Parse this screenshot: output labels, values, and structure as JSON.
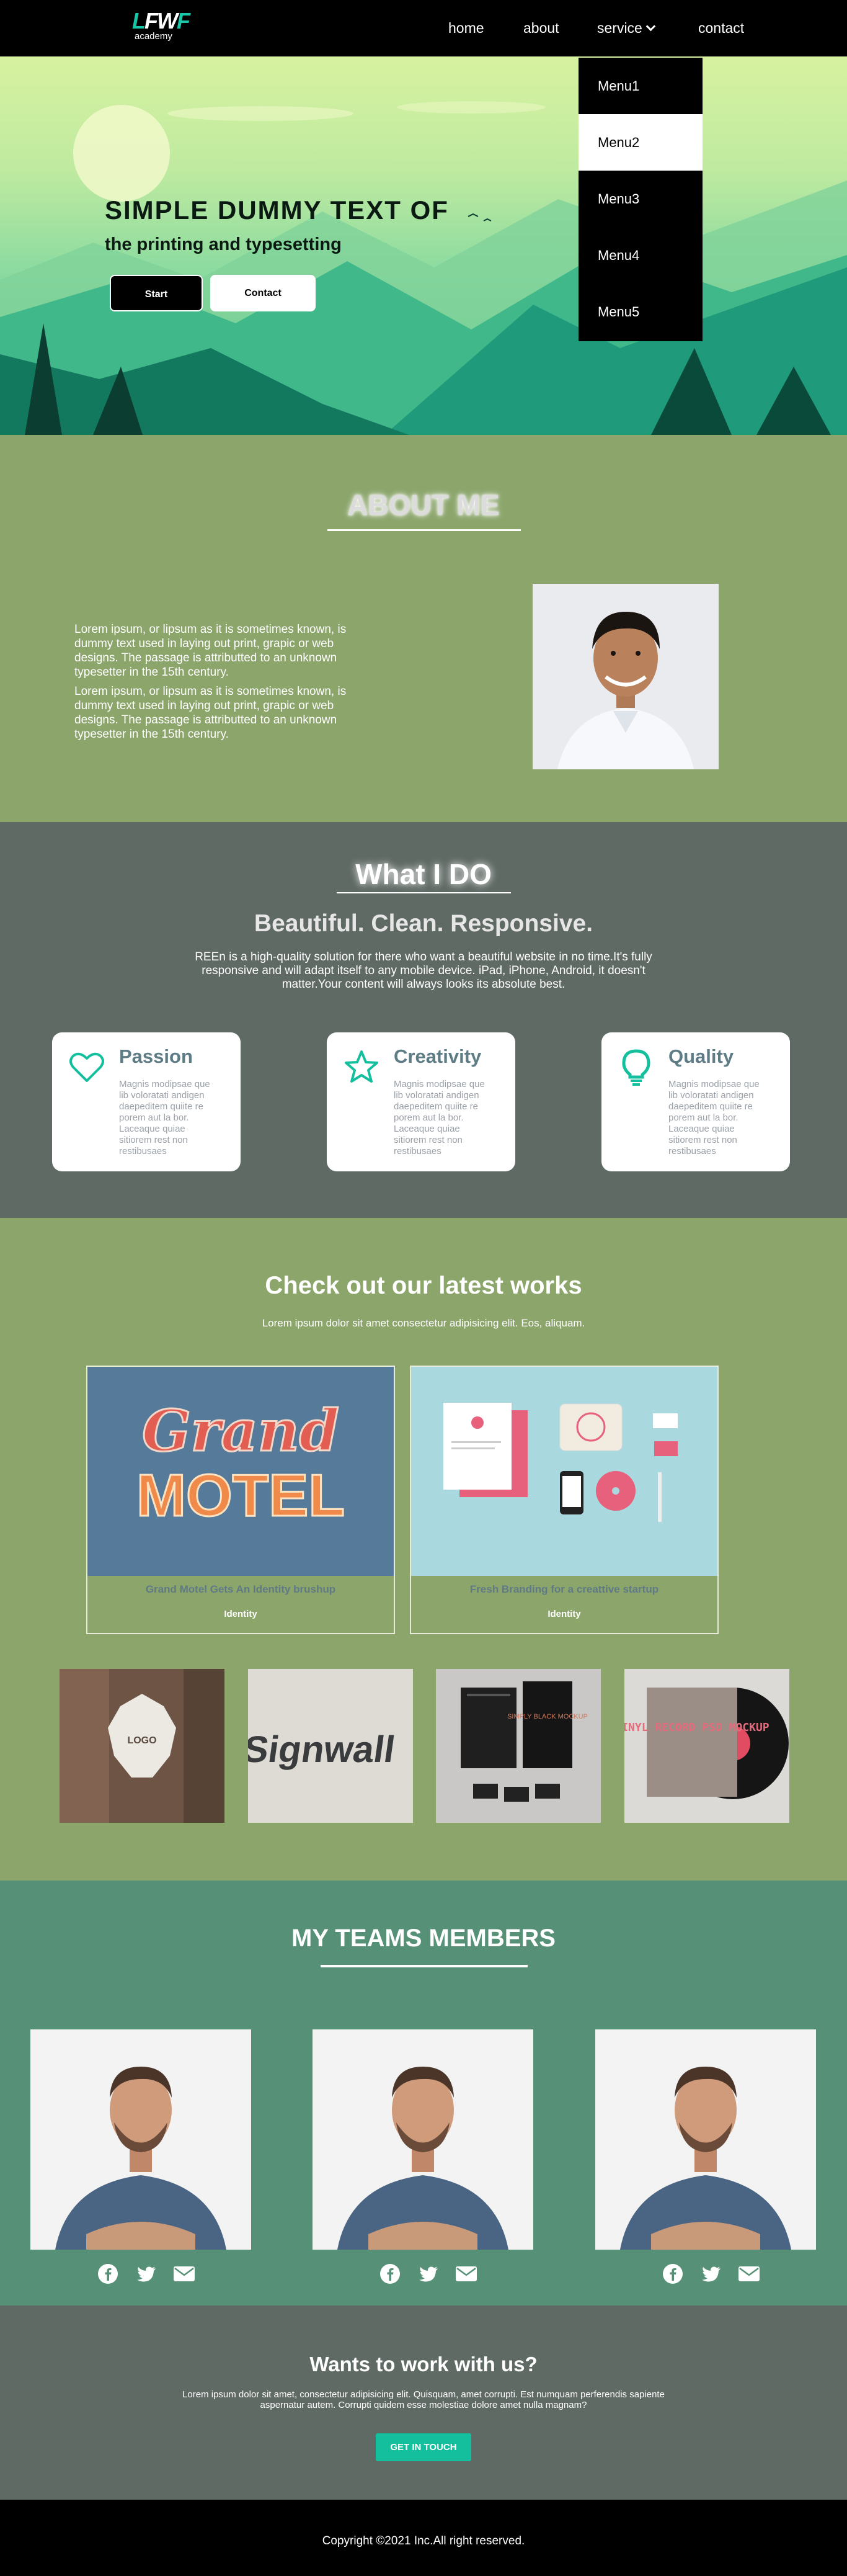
{
  "nav": {
    "logo_mark": "LFWF",
    "logo_sub": "academy",
    "items": [
      "home",
      "about",
      "service",
      "contact"
    ],
    "dropdown": [
      "Menu1",
      "Menu2",
      "Menu3",
      "Menu4",
      "Menu5"
    ]
  },
  "hero": {
    "title": "SIMPLE DUMMY TEXT OF",
    "subtitle": "the printing and typesetting",
    "start_label": "Start",
    "contact_label": "Contact"
  },
  "about": {
    "title": "ABOUT ME",
    "paragraphs": [
      "Lorem ipsum, or lipsum as it is sometimes known, is dummy text used in laying out print, grapic or web designs. The passage is attributted to an unknown typesetter in the 15th century.",
      "Lorem ipsum, or lipsum as it is sometimes known, is dummy text used in laying out print, grapic or web designs. The passage is attributted to an unknown typesetter in the 15th century."
    ]
  },
  "whatido": {
    "title": "What I DO",
    "subtitle": "Beautiful. Clean. Responsive.",
    "description": "REEn is a high-quality solution for there who want a beautiful website in no time.It's fully responsive and will adapt itself to any mobile device. iPad, iPhone, Android, it doesn't matter.Your content will always looks its absolute best.",
    "cards": [
      {
        "icon": "heart-icon",
        "title": "Passion",
        "text": "Magnis modipsae que lib voloratati andigen daepeditem quiite re porem aut la bor. Laceaque quiae sitiorem rest non restibusaes"
      },
      {
        "icon": "star-icon",
        "title": "Creativity",
        "text": "Magnis modipsae que lib voloratati andigen daepeditem quiite re porem aut la bor. Laceaque quiae sitiorem rest non restibusaes"
      },
      {
        "icon": "lightbulb-icon",
        "title": "Quality",
        "text": "Magnis modipsae que lib voloratati andigen daepeditem quiite re porem aut la bor. Laceaque quiae sitiorem rest non restibusaes"
      }
    ],
    "accent_color": "#14bf9e"
  },
  "works": {
    "title": "Check out our latest works",
    "description": "Lorem ipsum dolor sit amet consectetur adipisicing elit. Eos, aliquam.",
    "featured": [
      {
        "image_text_top": "Grand",
        "image_text_bottom": "MOTEL",
        "caption": "Grand Motel Gets An Identity brushup",
        "tag": "Identity"
      },
      {
        "caption": "Fresh Branding for a creattive startup",
        "tag": "Identity"
      }
    ],
    "thumbnails": [
      {
        "name": "badge-sign-thumbnail",
        "text": "LOGO"
      },
      {
        "name": "signwall-thumbnail",
        "text": "Signwall"
      },
      {
        "name": "black-stationery-thumbnail",
        "text": "SIMPLY BLACK MOCKUP"
      },
      {
        "name": "vinyl-record-thumbnail",
        "text": "VINYL RECORD PSD MOCKUP"
      }
    ]
  },
  "team": {
    "title": "MY TEAMS MEMBERS",
    "members": [
      {},
      {},
      {}
    ]
  },
  "cta": {
    "title": "Wants to work with us?",
    "description": "Lorem ipsum dolor sit amet, consectetur adipisicing elit. Quisquam, amet corrupti. Est numquam perferendis sapiente aspernatur autem. Corrupti quidem esse molestiae dolore amet nulla magnam?",
    "button_label": "GET IN TOUCH"
  },
  "footer": {
    "text": "Copyright ©2021 Inc.All right reserved."
  }
}
